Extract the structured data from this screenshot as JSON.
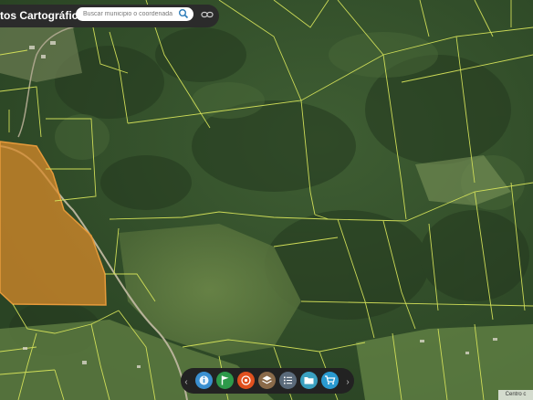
{
  "app": {
    "title": "tos Cartográficos"
  },
  "search": {
    "placeholder": "Buscar municipio o coordenada"
  },
  "toolbar": {
    "tools": [
      {
        "name": "info-tool",
        "color": "#3a8fd0"
      },
      {
        "name": "flag-tool",
        "color": "#2e9a4a"
      },
      {
        "name": "target-tool",
        "color": "#e0501e"
      },
      {
        "name": "layers-tool",
        "color": "#8a6a4a"
      },
      {
        "name": "list-tool",
        "color": "#5a6a7a"
      },
      {
        "name": "folder-tool",
        "color": "#3aa0c0"
      },
      {
        "name": "cart-tool",
        "color": "#2a9ad0"
      }
    ]
  },
  "scale": {
    "label": "Centro c"
  },
  "colors": {
    "parcel_line": "#d6e35a",
    "highlight_fill": "#d88a2a",
    "highlight_stroke": "#e69a3a"
  }
}
